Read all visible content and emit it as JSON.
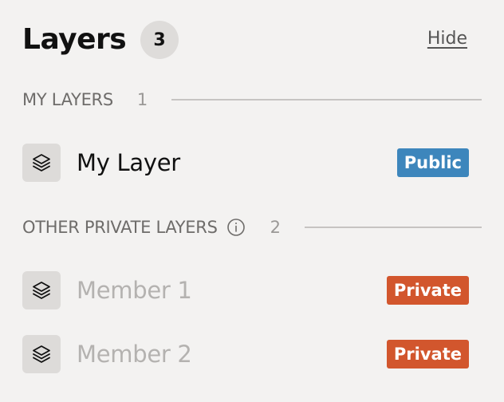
{
  "panel": {
    "title": "Layers",
    "count": "3",
    "hide_label": "Hide"
  },
  "my_layers": {
    "heading": "MY LAYERS",
    "count": "1",
    "items": [
      {
        "label": "My Layer",
        "tag": "Public",
        "tag_color": "#3d86bc",
        "icon": "layers-icon"
      }
    ]
  },
  "other_layers": {
    "heading": "OTHER PRIVATE LAYERS",
    "info_icon": "info-icon",
    "count": "2",
    "items": [
      {
        "label": "Member 1",
        "tag": "Private",
        "tag_color": "#d2562d",
        "icon": "layers-icon"
      },
      {
        "label": "Member 2",
        "tag": "Private",
        "tag_color": "#d2562d",
        "icon": "layers-icon"
      }
    ]
  },
  "colors": {
    "background": "#f3f2f1",
    "public": "#3d86bc",
    "private": "#d2562d"
  }
}
